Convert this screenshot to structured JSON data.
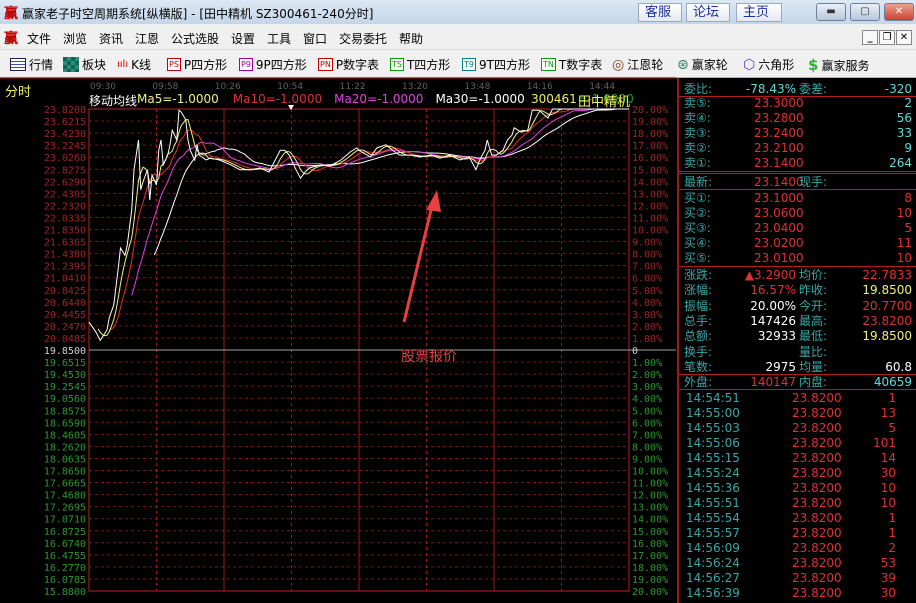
{
  "window": {
    "logo": "赢",
    "title": "赢家老子时空周期系统[纵横版] - [田中精机  SZ300461-240分时]",
    "links": [
      "客服",
      "论坛",
      "主页"
    ],
    "controls": [
      "minimize",
      "maximize",
      "close"
    ]
  },
  "menu": {
    "logo": "赢",
    "items": [
      "文件",
      "浏览",
      "资讯",
      "江恩",
      "公式选股",
      "设置",
      "工具",
      "窗口",
      "交易委托",
      "帮助"
    ]
  },
  "toolbar": [
    {
      "label": "行情",
      "icon": "grid-icon"
    },
    {
      "label": "板块",
      "icon": "blocks-icon"
    },
    {
      "label": "K线",
      "icon": "candlestick-icon"
    },
    {
      "label": "P四方形",
      "badge": "PS",
      "color": "#c00000"
    },
    {
      "label": "9P四方形",
      "badge": "P9",
      "color": "#a000a0"
    },
    {
      "label": "P数字表",
      "badge": "PN",
      "color": "#c00000"
    },
    {
      "label": "T四方形",
      "badge": "TS",
      "color": "#00a000"
    },
    {
      "label": "9T四方形",
      "badge": "T9",
      "color": "#008080"
    },
    {
      "label": "T数字表",
      "badge": "TN",
      "color": "#00a000"
    },
    {
      "label": "江恩轮",
      "icon": "target-icon"
    },
    {
      "label": "赢家轮",
      "icon": "wheel-icon"
    },
    {
      "label": "六角形",
      "icon": "hexagon-icon"
    },
    {
      "label": "赢家服务",
      "icon": "dollar-icon"
    }
  ],
  "chart": {
    "mode_label": "分时",
    "indicator_label": "移动均线",
    "ma_labels": [
      {
        "text": "Ma5=-1.0000",
        "color": "#f0f080"
      },
      {
        "text": "Ma10=-1.0000",
        "color": "#e03030"
      },
      {
        "text": "Ma20=-1.0000",
        "color": "#e040e0"
      },
      {
        "text": "Ma30=-1.0000",
        "color": "#ffffff"
      },
      {
        "text": "Ma250=-1.0000",
        "color": "#20a020"
      }
    ],
    "stock_code": "300461",
    "stock_name": "田中精机",
    "annotation": "股票报价"
  },
  "chart_data": {
    "type": "line",
    "x_ticks": [
      "09:30",
      "09:58",
      "10:26",
      "10:54",
      "11:22",
      "13:20",
      "13:48",
      "14:16",
      "14:44"
    ],
    "prev_close": 19.85,
    "ylim": [
      15.88,
      23.82
    ],
    "y_ticks_up": [
      "23.8200",
      "23.6215",
      "23.4230",
      "23.2245",
      "23.0260",
      "22.8275",
      "22.6290",
      "22.4305",
      "22.2320",
      "22.0335",
      "21.8350",
      "21.6365",
      "21.4380",
      "21.2395",
      "21.0410",
      "20.8425",
      "20.6440",
      "20.4455",
      "20.2470",
      "20.0485"
    ],
    "y_tick_mid": "19.8500",
    "y_ticks_down": [
      "19.6515",
      "19.4530",
      "19.2545",
      "19.0560",
      "18.8575",
      "18.6590",
      "18.4605",
      "18.2620",
      "18.0635",
      "17.8650",
      "17.6665",
      "17.4680",
      "17.2695",
      "17.0710",
      "16.8725",
      "16.6740",
      "16.4755",
      "16.2770",
      "16.0785",
      "15.8800"
    ],
    "pct_ticks_up": [
      "20.00%",
      "19.00%",
      "18.00%",
      "17.00%",
      "16.00%",
      "15.00%",
      "14.00%",
      "13.00%",
      "12.00%",
      "11.00%",
      "10.00%",
      "9.00%",
      "8.00%",
      "7.00%",
      "6.00%",
      "5.00%",
      "4.00%",
      "3.00%",
      "2.00%",
      "1.00%"
    ],
    "pct_tick_mid": "0",
    "pct_ticks_down": [
      "1.00%",
      "2.00%",
      "3.00%",
      "4.00%",
      "5.00%",
      "6.00%",
      "7.00%",
      "8.00%",
      "9.00%",
      "10.00%",
      "11.00%",
      "12.00%",
      "13.00%",
      "14.00%",
      "15.00%",
      "16.00%",
      "17.00%",
      "18.00%",
      "19.00%",
      "20.00%"
    ],
    "grid": true,
    "price_series": [
      [
        "09:30",
        20.31
      ],
      [
        "09:33",
        20.15
      ],
      [
        "09:35",
        20.01
      ],
      [
        "09:38",
        20.18
      ],
      [
        "09:39",
        20.38
      ],
      [
        "09:41",
        20.59
      ],
      [
        "09:43",
        21.2
      ],
      [
        "09:44",
        21.53
      ],
      [
        "09:46",
        21.41
      ],
      [
        "09:47",
        21.58
      ],
      [
        "09:49",
        22.16
      ],
      [
        "09:50",
        22.82
      ],
      [
        "09:52",
        23.31
      ],
      [
        "09:53",
        22.49
      ],
      [
        "09:54",
        22.62
      ],
      [
        "09:56",
        22.82
      ],
      [
        "09:57",
        22.32
      ],
      [
        "09:58",
        22.73
      ],
      [
        "10:00",
        22.57
      ],
      [
        "10:01",
        23.14
      ],
      [
        "10:02",
        23.31
      ],
      [
        "10:03",
        22.9
      ],
      [
        "10:05",
        23.06
      ],
      [
        "10:06",
        23.23
      ],
      [
        "10:07",
        23.47
      ],
      [
        "10:09",
        23.31
      ],
      [
        "10:10",
        23.8
      ],
      [
        "10:11",
        23.77
      ],
      [
        "10:13",
        23.64
      ],
      [
        "10:14",
        23.31
      ],
      [
        "10:15",
        23.14
      ],
      [
        "10:17",
        22.98
      ],
      [
        "10:18",
        23.23
      ],
      [
        "10:19",
        23.06
      ],
      [
        "10:22",
        22.98
      ],
      [
        "10:24",
        23.01
      ],
      [
        "10:28",
        22.98
      ],
      [
        "10:33",
        22.9
      ],
      [
        "10:37",
        22.82
      ],
      [
        "10:42",
        22.82
      ],
      [
        "10:46",
        22.85
      ],
      [
        "10:50",
        22.78
      ],
      [
        "10:55",
        23.14
      ],
      [
        "10:57",
        23.14
      ],
      [
        "10:59",
        23.06
      ],
      [
        "11:02",
        22.82
      ],
      [
        "11:04",
        22.68
      ],
      [
        "11:06",
        22.78
      ],
      [
        "11:08",
        22.85
      ],
      [
        "11:13",
        22.9
      ],
      [
        "11:17",
        22.88
      ],
      [
        "11:22",
        22.98
      ],
      [
        "11:26",
        23.11
      ],
      [
        "11:29",
        23.18
      ],
      [
        "13:00",
        23.14
      ],
      [
        "13:05",
        23.03
      ],
      [
        "13:08",
        23.18
      ],
      [
        "13:12",
        23.23
      ],
      [
        "13:15",
        23.14
      ],
      [
        "13:18",
        23.06
      ],
      [
        "13:23",
        23.06
      ],
      [
        "13:27",
        23.03
      ],
      [
        "13:32",
        23.06
      ],
      [
        "13:36",
        23.01
      ],
      [
        "13:40",
        23.06
      ],
      [
        "13:45",
        22.98
      ],
      [
        "13:49",
        23.03
      ],
      [
        "13:52",
        22.82
      ],
      [
        "13:54",
        23.01
      ],
      [
        "13:56",
        23.14
      ],
      [
        "13:57",
        23.31
      ],
      [
        "13:59",
        23.06
      ],
      [
        "14:01",
        23.06
      ],
      [
        "14:04",
        23.14
      ],
      [
        "14:06",
        23.31
      ],
      [
        "14:08",
        23.39
      ],
      [
        "14:09",
        23.51
      ],
      [
        "14:12",
        23.44
      ],
      [
        "14:15",
        23.47
      ],
      [
        "14:17",
        23.8
      ],
      [
        "14:20",
        23.8
      ],
      [
        "14:24",
        23.67
      ],
      [
        "14:26",
        23.82
      ],
      [
        "14:29",
        23.82
      ],
      [
        "14:47",
        23.82
      ],
      [
        "15:00",
        23.82
      ]
    ],
    "ma_colors": {
      "ma5": "#f0f080",
      "ma10": "#e03030",
      "ma20": "#e040e0",
      "ma30": "#ffffff"
    },
    "price_color": "#ffffff"
  },
  "quote": {
    "weibi": {
      "label": "委比:",
      "value": "-78.43%",
      "label2": "委差:",
      "value2": "-320"
    },
    "sells": [
      {
        "label": "卖⑤:",
        "price": "23.3000",
        "vol": "2"
      },
      {
        "label": "卖④:",
        "price": "23.2800",
        "vol": "56"
      },
      {
        "label": "卖③:",
        "price": "23.2400",
        "vol": "33"
      },
      {
        "label": "卖②:",
        "price": "23.2100",
        "vol": "9"
      },
      {
        "label": "卖①:",
        "price": "23.1400",
        "vol": "264"
      }
    ],
    "latest": {
      "label": "最新:",
      "value": "23.1400",
      "label2": "现手:"
    },
    "buys": [
      {
        "label": "买①:",
        "price": "23.1000",
        "vol": "8"
      },
      {
        "label": "买②:",
        "price": "23.0600",
        "vol": "10"
      },
      {
        "label": "买③:",
        "price": "23.0400",
        "vol": "5"
      },
      {
        "label": "买④:",
        "price": "23.0200",
        "vol": "11"
      },
      {
        "label": "买⑤:",
        "price": "23.0100",
        "vol": "10"
      }
    ],
    "stats": [
      {
        "l1": "涨跌:",
        "v1": "▲3.2900",
        "c1": "red",
        "l2": "均价:",
        "v2": "22.7833",
        "c2": "red"
      },
      {
        "l1": "涨幅:",
        "v1": "16.57%",
        "c1": "red",
        "l2": "昨收:",
        "v2": "19.8500",
        "c2": "yel"
      },
      {
        "l1": "振幅:",
        "v1": "20.00%",
        "c1": "wht",
        "l2": "今开:",
        "v2": "20.7700",
        "c2": "red"
      },
      {
        "l1": "总手:",
        "v1": "147426",
        "c1": "wht",
        "l2": "最高:",
        "v2": "23.8200",
        "c2": "red"
      },
      {
        "l1": "总额:",
        "v1": "32933",
        "c1": "wht",
        "l2": "最低:",
        "v2": "19.8500",
        "c2": "yel"
      },
      {
        "l1": "换手:",
        "v1": "",
        "c1": "wht",
        "l2": "量比:",
        "v2": "",
        "c2": "wht"
      },
      {
        "l1": "笔数:",
        "v1": "2975",
        "c1": "wht",
        "l2": "均量:",
        "v2": "60.8",
        "c2": "wht"
      }
    ],
    "outer": {
      "label": "外盘:",
      "value": "140147",
      "label2": "内盘:",
      "value2": "40659"
    },
    "ticks": [
      [
        "14:54:51",
        "23.8200",
        "1"
      ],
      [
        "14:55:00",
        "23.8200",
        "13"
      ],
      [
        "14:55:03",
        "23.8200",
        "5"
      ],
      [
        "14:55:06",
        "23.8200",
        "101"
      ],
      [
        "14:55:15",
        "23.8200",
        "14"
      ],
      [
        "14:55:24",
        "23.8200",
        "30"
      ],
      [
        "14:55:36",
        "23.8200",
        "10"
      ],
      [
        "14:55:51",
        "23.8200",
        "10"
      ],
      [
        "14:55:54",
        "23.8200",
        "1"
      ],
      [
        "14:55:57",
        "23.8200",
        "1"
      ],
      [
        "14:56:09",
        "23.8200",
        "2"
      ],
      [
        "14:56:24",
        "23.8200",
        "53"
      ],
      [
        "14:56:27",
        "23.8200",
        "39"
      ],
      [
        "14:56:39",
        "23.8200",
        "30"
      ]
    ]
  }
}
